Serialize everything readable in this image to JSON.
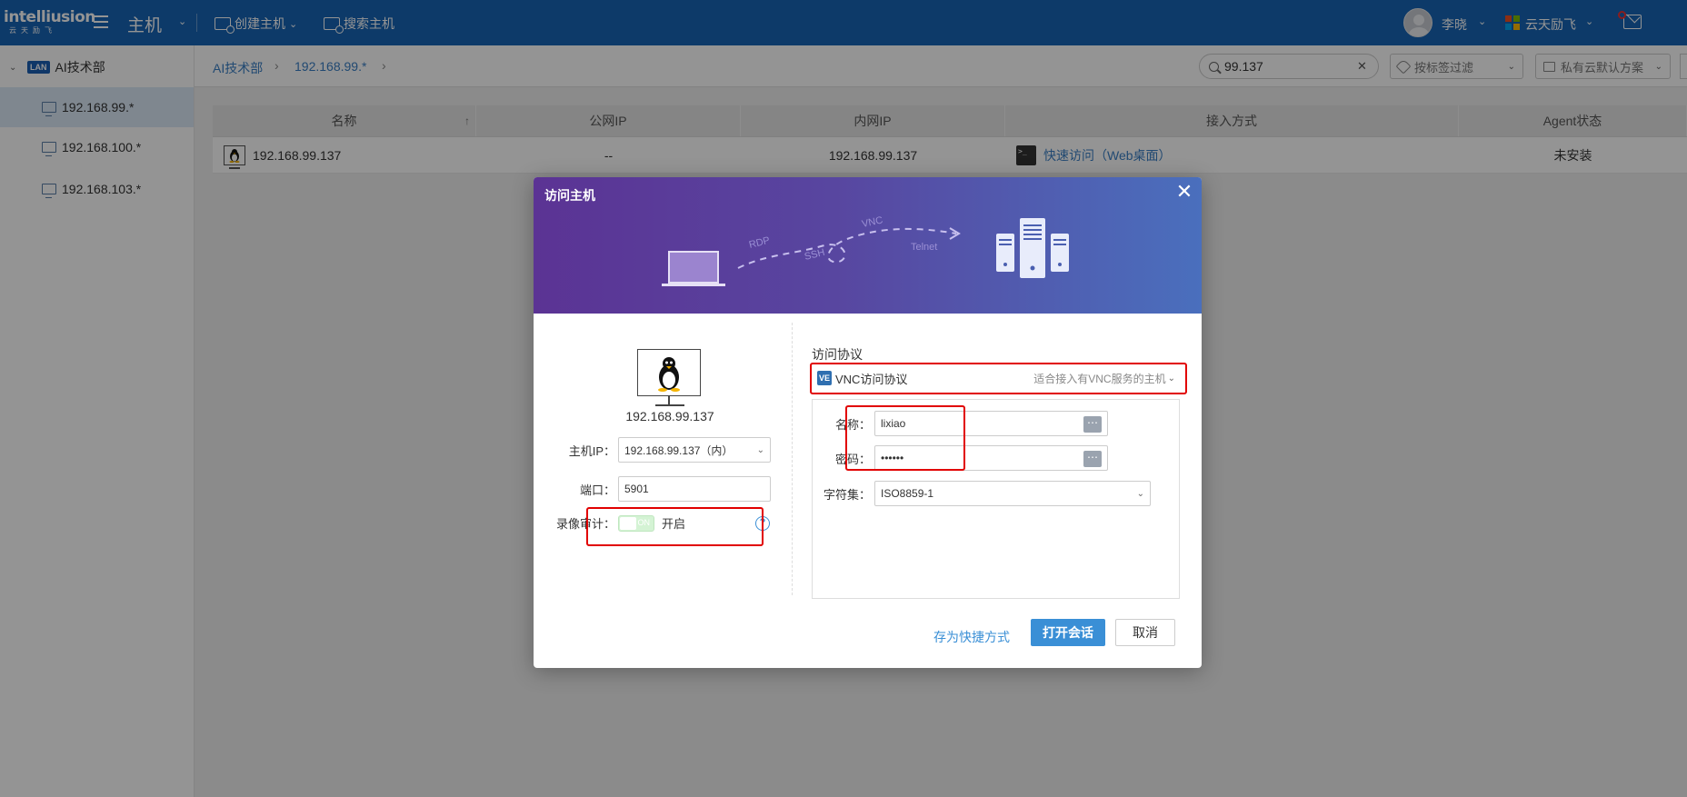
{
  "topbar": {
    "logo_brand": "intelliusion",
    "logo_sub": "云天励飞",
    "module_title": "主机",
    "create_host": "创建主机",
    "search_host": "搜索主机",
    "user_name": "李晓",
    "tenant_name": "云天励飞"
  },
  "sidebar": {
    "root": {
      "badge": "LAN",
      "label": "AI技术部"
    },
    "items": [
      {
        "label": "192.168.99.*",
        "active": true
      },
      {
        "label": "192.168.100.*",
        "active": false
      },
      {
        "label": "192.168.103.*",
        "active": false
      }
    ]
  },
  "breadcrumb": {
    "items": [
      "AI技术部",
      "192.168.99.*"
    ]
  },
  "filters": {
    "search_value": "99.137",
    "tag_filter_placeholder": "按标签过滤",
    "plan_filter": "私有云默认方案"
  },
  "table": {
    "headers": [
      "名称",
      "公网IP",
      "内网IP",
      "接入方式",
      "Agent状态"
    ],
    "rows": [
      {
        "name": "192.168.99.137",
        "public_ip": "--",
        "private_ip": "192.168.99.137",
        "access": "快速访问（Web桌面）",
        "agent_status": "未安装"
      }
    ]
  },
  "dialog": {
    "title": "访问主机",
    "banner_labels": [
      "RDP",
      "SSH",
      "VNC",
      "Telnet"
    ],
    "host_ip": "192.168.99.137",
    "host_ip_label": "主机IP：",
    "host_ip_select": "192.168.99.137（内）",
    "port_label": "端口：",
    "port_value": "5901",
    "record_label": "录像审计：",
    "record_toggle": "ON",
    "record_state": "开启",
    "help_glyph": "?",
    "protocol_label": "访问协议",
    "protocol_badge": "VE",
    "protocol_value": "VNC访问协议",
    "protocol_hint": "适合接入有VNC服务的主机",
    "name_label": "名称：",
    "name_value": "lixiao",
    "password_label": "密码：",
    "password_value": "••••••",
    "charset_label": "字符集：",
    "charset_value": "ISO8859-1",
    "save_shortcut": "存为快捷方式",
    "open_session": "打开会话",
    "cancel": "取消"
  },
  "colors": {
    "topbar": "#1764b5",
    "accent": "#3a8fd6",
    "highlight_box": "#e10000",
    "banner_start": "#5b3394",
    "banner_end": "#4a6fbd"
  }
}
